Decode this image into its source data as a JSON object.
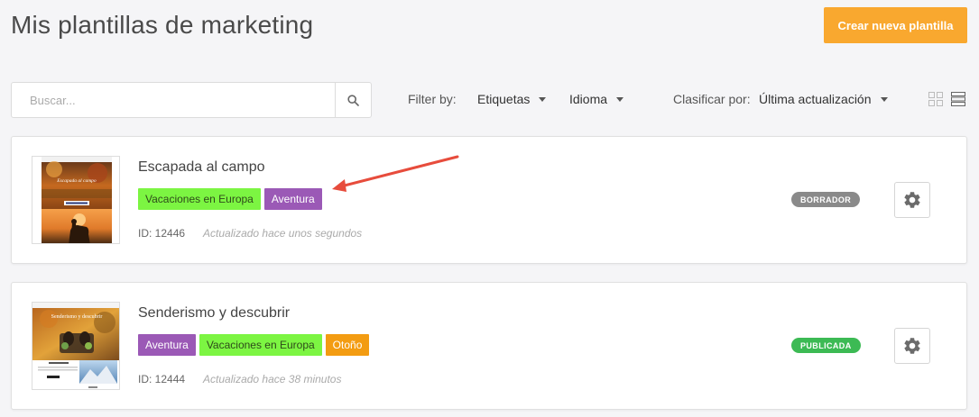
{
  "header": {
    "title": "Mis plantillas de marketing",
    "create_label": "Crear nueva plantilla"
  },
  "search": {
    "placeholder": "Buscar...",
    "value": ""
  },
  "filters": {
    "filter_by_label": "Filter by:",
    "etiquetas_label": "Etiquetas",
    "idioma_label": "Idioma",
    "sort_label": "Clasificar por:",
    "sort_value": "Última actualización"
  },
  "colors": {
    "accent": "#f9a82f",
    "tag_green": "#7cf542",
    "tag_purple": "#9b59b6",
    "tag_orange": "#f39c12",
    "status_draft": "#8a8a8a",
    "status_published": "#3cba54",
    "arrow": "#e74c3c"
  },
  "templates": [
    {
      "title": "Escapada al campo",
      "tags": [
        {
          "label": "Vacaciones en Europa",
          "color": "green"
        },
        {
          "label": "Aventura",
          "color": "purple"
        }
      ],
      "id_text": "ID: 12446",
      "updated": "Actualizado hace unos segundos",
      "status": "BORRADOR",
      "thumb_text": "Escapada al campo"
    },
    {
      "title": "Senderismo y descubrir",
      "tags": [
        {
          "label": "Aventura",
          "color": "purple"
        },
        {
          "label": "Vacaciones en Europa",
          "color": "green"
        },
        {
          "label": "Otoño",
          "color": "orange"
        }
      ],
      "id_text": "ID: 12444",
      "updated": "Actualizado hace 38 minutos",
      "status": "PUBLICADA",
      "thumb_text": "Senderismo y descubrir"
    }
  ]
}
